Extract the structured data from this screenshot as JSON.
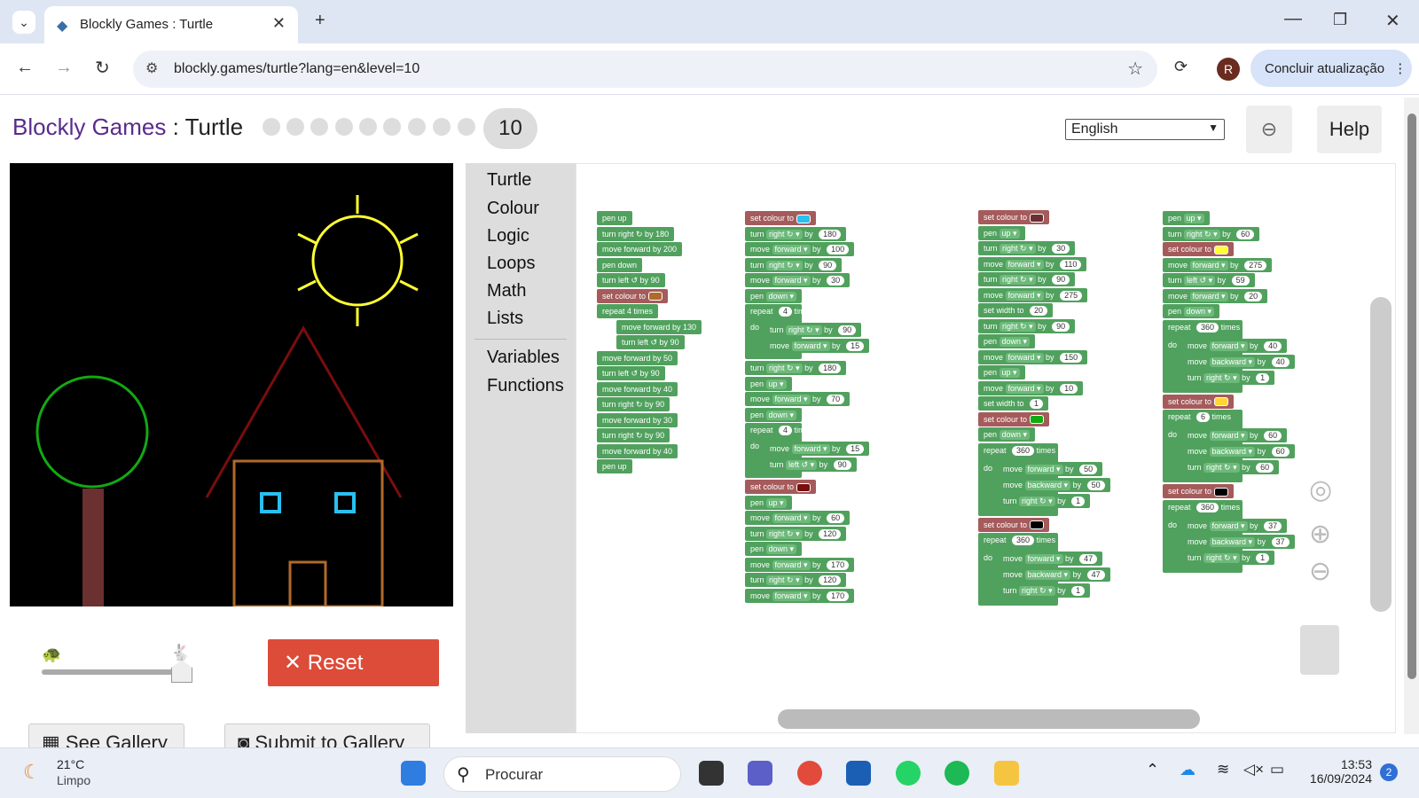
{
  "browser": {
    "tab_title": "Blockly Games : Turtle",
    "url": "blockly.games/turtle?lang=en&level=10",
    "avatar_initial": "R",
    "update_label": "Concluir atualização"
  },
  "page": {
    "brand": "Blockly Games",
    "separator": " : ",
    "game": "Turtle",
    "level": "10",
    "language": "English",
    "help_label": "Help",
    "reset_label": "Reset",
    "gallery_label": "See Gallery",
    "submit_label": "Submit to Gallery"
  },
  "toolbox": [
    "Turtle",
    "Colour",
    "Logic",
    "Loops",
    "Math",
    "Lists",
    "Variables",
    "Functions"
  ],
  "blocks": {
    "stack1": [
      "pen up",
      "turn right ↻ by 180",
      "move forward by 200",
      "pen down",
      "turn left ↺ by 90",
      "set colour to",
      "repeat 4 times",
      "move forward by 130",
      "turn left ↺ by 90",
      "move forward by 50",
      "turn left ↺ by 90",
      "move forward by 40",
      "turn right ↻ by 90",
      "move forward by 30",
      "turn right ↻ by 90",
      "move forward by 40",
      "pen up"
    ]
  },
  "taskbar": {
    "temp": "21°C",
    "weather": "Limpo",
    "search": "Procurar",
    "time": "13:53",
    "date": "16/09/2024",
    "notif": "2"
  }
}
